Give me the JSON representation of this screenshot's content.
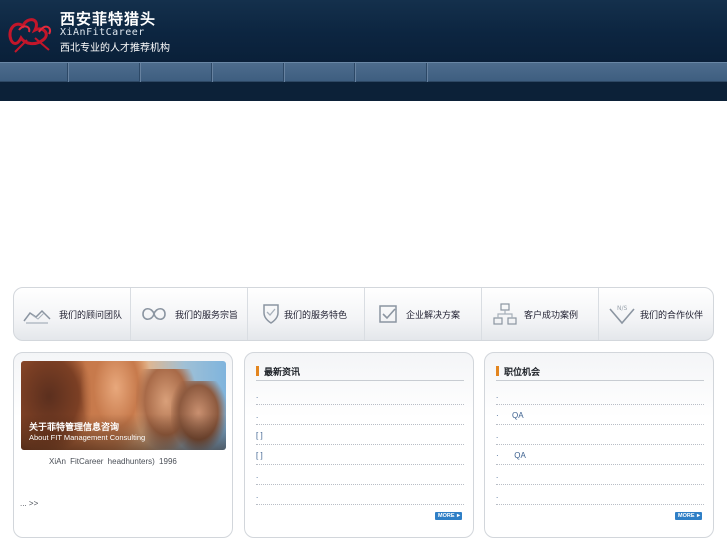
{
  "header": {
    "brand_title": "西安菲特猎头",
    "brand_en": "XiAnFitCareer",
    "brand_sub": "西北专业的人才推荐机构",
    "date_text": ""
  },
  "nav": {
    "items": [
      "",
      "",
      "",
      "",
      "",
      ""
    ]
  },
  "features": [
    {
      "icon": "handshake-icon",
      "label": "我们的顾问团队"
    },
    {
      "icon": "infinity-icon",
      "label": "我们的服务宗旨"
    },
    {
      "icon": "shield-icon",
      "label": "我们的服务特色"
    },
    {
      "icon": "checklist-icon",
      "label": "企业解决方案"
    },
    {
      "icon": "network-icon",
      "label": "客户成功案例"
    },
    {
      "icon": "ns-badge-icon",
      "label": "我们的合作伙伴"
    }
  ],
  "about": {
    "photo_title": "关于菲特管理信息咨询",
    "photo_subtitle": "About FIT Management Consulting",
    "text": "XiAn FitCareer headhunters)    1996",
    "more": "... >>"
  },
  "news": {
    "title": "最新资讯",
    "items": [
      ".",
      ".",
      "[ ]",
      "[ ]",
      ".",
      "."
    ],
    "more_label": "MORE"
  },
  "jobs": {
    "title": "职位机会",
    "items": [
      ".",
      "·      QA",
      ".",
      "·       QA",
      ".",
      "."
    ],
    "more_label": "MORE"
  },
  "colors": {
    "header_bg": "#0c2540",
    "nav_bg": "#456587",
    "accent_orange": "#e3851e",
    "more_blue": "#2f7fc6",
    "link_blue": "#3a5f8e"
  }
}
